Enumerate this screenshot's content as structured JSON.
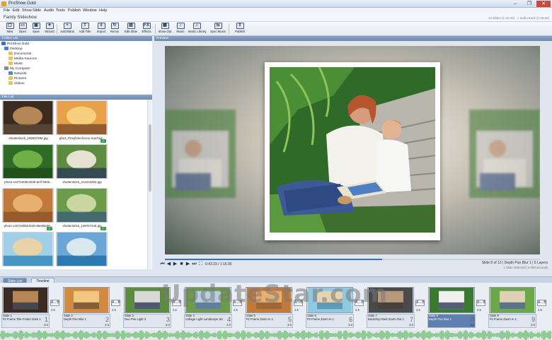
{
  "window": {
    "title": "ProShow Gold",
    "min": "–",
    "max": "❐",
    "close": "✕"
  },
  "menu": [
    "File",
    "Edit",
    "Show",
    "Slide",
    "Audio",
    "Tools",
    "Publish",
    "Window",
    "Help"
  ],
  "doc": {
    "title": "Family Slideshow",
    "status": "13 slides (1:15.00) · 1 audio track (1:28.60)"
  },
  "toolbar": [
    {
      "id": "new",
      "label": "New",
      "glyph": "▢"
    },
    {
      "id": "open",
      "label": "Open",
      "glyph": "▭"
    },
    {
      "id": "save",
      "label": "Save",
      "glyph": "▣"
    },
    {
      "id": "wizard",
      "label": "Wizard",
      "glyph": "✦"
    },
    {
      "id": "add-blank",
      "label": "Add Blank",
      "glyph": "+"
    },
    {
      "id": "add-title",
      "label": "Add Title",
      "glyph": "T"
    },
    {
      "id": "import",
      "label": "Import",
      "glyph": "⇩"
    },
    {
      "id": "remix",
      "label": "Remix",
      "glyph": "↻"
    },
    {
      "id": "edit-slide",
      "label": "Edit Slide",
      "glyph": "▤"
    },
    {
      "id": "effects",
      "label": "Effects",
      "glyph": "FX"
    },
    {
      "id": "show-opt",
      "label": "Show Opt",
      "glyph": "▦"
    },
    {
      "id": "music",
      "label": "Music",
      "glyph": "♪"
    },
    {
      "id": "music-library",
      "label": "Music Library",
      "glyph": "♫"
    },
    {
      "id": "sync-music",
      "label": "Sync Music",
      "glyph": "⇆"
    },
    {
      "id": "publish",
      "label": "Publish",
      "glyph": "⇪"
    }
  ],
  "folder_list": {
    "header": "Folder List",
    "items": [
      {
        "label": "ProShow Gold",
        "indent": 0
      },
      {
        "label": "Desktop",
        "indent": 1
      },
      {
        "label": "Documents",
        "indent": 2
      },
      {
        "label": "Media Sources",
        "indent": 2
      },
      {
        "label": "Music",
        "indent": 2
      },
      {
        "label": "My Computer",
        "indent": 1
      },
      {
        "label": "Network",
        "indent": 2
      },
      {
        "label": "Pictures",
        "indent": 2
      },
      {
        "label": "Videos",
        "indent": 2
      }
    ]
  },
  "file_list": {
    "header": "File List",
    "files": [
      {
        "name": "shutterstock_185607392.jpg",
        "colors": [
          "#3a2a20",
          "#b48656",
          "#5c4a3a"
        ],
        "used": false
      },
      {
        "name": "gbo4_Pexphoto-bruno-machad...",
        "colors": [
          "#e9a04a",
          "#f6d07c",
          "#7a4b2a"
        ],
        "used": true
      },
      {
        "name": "photo-1427100912635-5ef72846...",
        "colors": [
          "#2f6b25",
          "#6fb046",
          "#1e4a18"
        ],
        "used": false
      },
      {
        "name": "shutterstock_214413302.jpg",
        "colors": [
          "#5d8c3e",
          "#e6e2d2",
          "#2c3b57"
        ],
        "used": false
      },
      {
        "name": "photo-1427100912645-86e96109...",
        "colors": [
          "#c27a3a",
          "#e8b070",
          "#8c5428"
        ],
        "used": true
      },
      {
        "name": "shutterstock_108767445.jpg",
        "colors": [
          "#6a9c4a",
          "#c9d6a0",
          "#3a5e78"
        ],
        "used": true
      },
      {
        "name": "",
        "colors": [
          "#9fd0e8",
          "#e8d2a8",
          "#2f86b8"
        ],
        "used": false
      },
      {
        "name": "",
        "colors": [
          "#6aa6d6",
          "#d9e8f0",
          "#1e6fa8"
        ],
        "used": true
      }
    ]
  },
  "preview": {
    "header": "Preview",
    "time": "0:43.23 / 1:15.00",
    "progress": 0.58,
    "slide_info": "Slide 8 of 13  |  Depth Pan Blur 1  |  5 Layers",
    "slide_info2": "1 Slide Selected  |  3.000 seconds"
  },
  "tabs": {
    "slide_list": "Slide List",
    "timeline": "Timeline"
  },
  "watermark": "UpdateStar.com",
  "slides": [
    {
      "title": "Slide 1",
      "effect": "Fit Frame Title Footer Dark 1",
      "num": "1",
      "dur": "3.0",
      "trans_dur": "2.5",
      "colors": [
        "#3a2a20",
        "#b48656",
        "#2a3450"
      ]
    },
    {
      "title": "Slide 2",
      "effect": "Depth Pan Blur 1",
      "num": "2",
      "dur": "3.0",
      "trans_dur": "2.5",
      "colors": [
        "#d08a42",
        "#f2c880",
        "#6a4428"
      ]
    },
    {
      "title": "Slide 3",
      "effect": "Duo Pan Light 3",
      "num": "3",
      "dur": "3.0",
      "trans_dur": "2.5",
      "colors": [
        "#5d8c3e",
        "#d8d8d8",
        "#2c3b57"
      ]
    },
    {
      "title": "Slide 4",
      "effect": "Collage Light Landscape 3in",
      "num": "4",
      "dur": "4.0",
      "trans_dur": "2.5",
      "colors": [
        "#6a9c4a",
        "#b8cfe0",
        "#4a6a88"
      ]
    },
    {
      "title": "Slide 5",
      "effect": "Fit Frame Zoom In 1",
      "num": "5",
      "dur": "3.0",
      "trans_dur": "2.5",
      "colors": [
        "#c27a3a",
        "#e8b070",
        "#8c5428"
      ]
    },
    {
      "title": "Slide 6",
      "effect": "Fit Frame Zoom In 1",
      "num": "6",
      "dur": "3.0",
      "trans_dur": "2.5",
      "colors": [
        "#8fc8e0",
        "#e6d4b0",
        "#3f8ab8"
      ]
    },
    {
      "title": "Slide 7",
      "effect": "Backdrop Dark Zoom Out 1",
      "num": "7",
      "dur": "3.0",
      "trans_dur": "2.5",
      "colors": [
        "#4a4a4a",
        "#b89a7a",
        "#2a2a2a"
      ]
    },
    {
      "title": "Slide 8",
      "effect": "Depth Pan Blur 1",
      "num": "8",
      "dur": "3.0",
      "trans_dur": "2.5",
      "colors": [
        "#3a7a30",
        "#f0f0f0",
        "#2c3b57"
      ],
      "selected": true
    },
    {
      "title": "Slide 9",
      "effect": "Fit Frame Zoom In 1",
      "num": "9",
      "dur": "3.0",
      "trans_dur": "2.5",
      "colors": [
        "#6aa84a",
        "#e0d0b8",
        "#3a5e78"
      ]
    }
  ]
}
